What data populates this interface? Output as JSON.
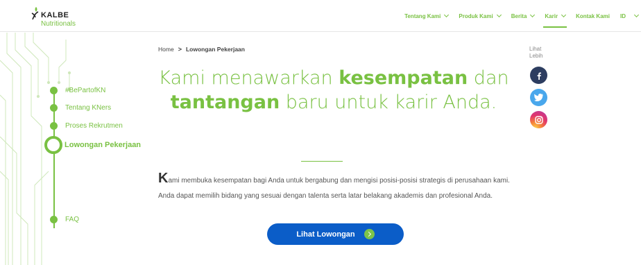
{
  "brand": {
    "name": "KALBE",
    "sub": "Nutritionals"
  },
  "nav": [
    {
      "label": "Tentang Kami",
      "dropdown": true
    },
    {
      "label": "Produk Kami",
      "dropdown": true
    },
    {
      "label": "Berita",
      "dropdown": true
    },
    {
      "label": "Karir",
      "dropdown": true,
      "active": true
    },
    {
      "label": "Kontak Kami",
      "dropdown": false
    },
    {
      "label": "ID",
      "dropdown": true
    }
  ],
  "sidebar": {
    "items": [
      {
        "label": "#BePartofKN"
      },
      {
        "label": "Tentang KNers"
      },
      {
        "label": "Proses Rekrutmen"
      },
      {
        "label": "Lowongan Pekerjaan",
        "active": true
      },
      {
        "label": "FAQ"
      }
    ]
  },
  "breadcrumb": {
    "home": "Home",
    "separator": ">",
    "current": "Lowongan Pekerjaan"
  },
  "headline": {
    "part1": "Kami menawarkan ",
    "bold1": "kesempatan",
    "part2": " dan ",
    "bold2": "tantangan",
    "part3": " baru untuk karir Anda."
  },
  "body": {
    "dropcap": "K",
    "text": "ami membuka kesempatan bagi Anda untuk bergabung dan mengisi posisi-posisi strategis di perusahaan kami. Anda dapat memilih bidang yang sesuai dengan talenta serta latar belakang akademis dan profesional Anda."
  },
  "cta": {
    "label": "Lihat Lowongan"
  },
  "share": {
    "label": "Lihat Lebih"
  },
  "social": [
    {
      "name": "facebook-icon",
      "color": "#2d3d60"
    },
    {
      "name": "twitter-icon",
      "color": "#49a7ec"
    },
    {
      "name": "instagram-icon",
      "color": "#e2366c"
    }
  ],
  "colors": {
    "accent": "#79c142",
    "button": "#0b5dc8",
    "text": "#555555"
  }
}
